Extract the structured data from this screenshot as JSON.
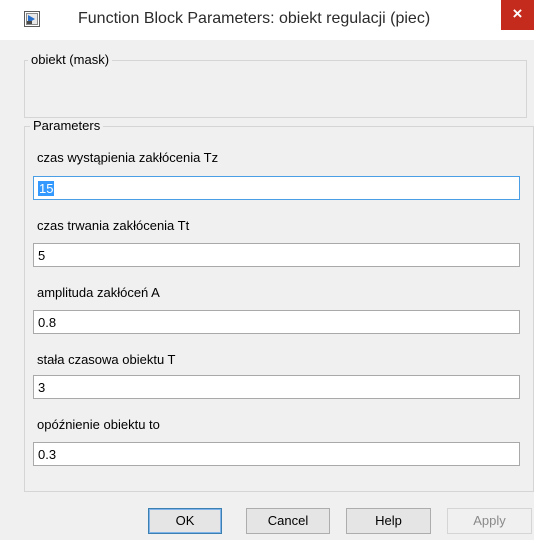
{
  "window": {
    "title": "Function Block Parameters: obiekt regulacji (piec)",
    "close_glyph": "×",
    "icon": "simulink-block-icon",
    "close_color": "#c42b1c"
  },
  "mask": {
    "legend": "obiekt (mask)"
  },
  "parameters": {
    "legend": "Parameters",
    "items": [
      {
        "label": "czas wystąpienia zakłócenia Tz",
        "value": "15"
      },
      {
        "label": "czas trwania zakłócenia Tt",
        "value": "5"
      },
      {
        "label": "amplituda zakłóceń A",
        "value": "0.8"
      },
      {
        "label": "stała czasowa obiektu T",
        "value": "3"
      },
      {
        "label": "opóźnienie obiektu to",
        "value": "0.3"
      }
    ]
  },
  "buttons": {
    "ok": "OK",
    "cancel": "Cancel",
    "help": "Help",
    "apply": "Apply"
  }
}
